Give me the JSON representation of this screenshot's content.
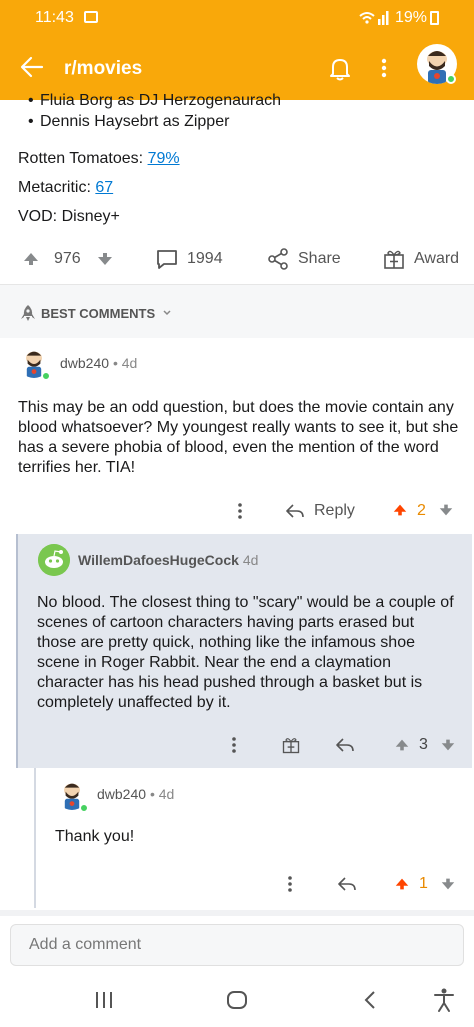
{
  "status_bar": {
    "time": "11:43",
    "battery_percent": "19%"
  },
  "app_bar": {
    "title": "r/movies"
  },
  "post": {
    "cast_items": [
      "Fluia Borg as DJ Herzogenaurach",
      "Dennis Haysebrt as Zipper"
    ],
    "rotten_tomatoes_label": "Rotten Tomatoes:",
    "rotten_tomatoes_value": "79%",
    "metacritic_label": "Metacritic:",
    "metacritic_value": "67",
    "vod_label": "VOD:",
    "vod_value": "Disney+",
    "score": "976",
    "comment_count": "1994",
    "share_label": "Share",
    "award_label": "Award"
  },
  "comments_header": {
    "sort_label": "BEST COMMENTS"
  },
  "comments": [
    {
      "author": "dwb240",
      "age": "4d",
      "body": "This may be an odd question, but does the movie contain any blood whatsoever? My youngest really wants to see it, but she has a severe phobia of blood, even the mention of the word terrifies her. TIA!",
      "reply_label": "Reply",
      "score": "2",
      "vote_state": "upvoted"
    },
    {
      "author": "WillemDafoesHugeCock",
      "age": "4d",
      "body": "No blood. The closest thing to \"scary\" would be a couple of scenes of cartoon characters having parts erased but those are pretty quick, nothing like the infamous shoe scene in Roger Rabbit. Near the end a claymation character has his head pushed through a basket but is completely unaffected by it.",
      "score": "3",
      "vote_state": "none"
    },
    {
      "author": "dwb240",
      "age": "4d",
      "body": "Thank you!",
      "score": "1",
      "vote_state": "upvoted"
    }
  ],
  "composer": {
    "placeholder": "Add a comment"
  },
  "colors": {
    "header_orange": "#f9a80a",
    "upvote_orange": "#ff4500",
    "score_orange": "#e98a00",
    "link_blue": "#0079d3",
    "nested_bg": "#e3e7ee",
    "online_green": "#46d160"
  }
}
